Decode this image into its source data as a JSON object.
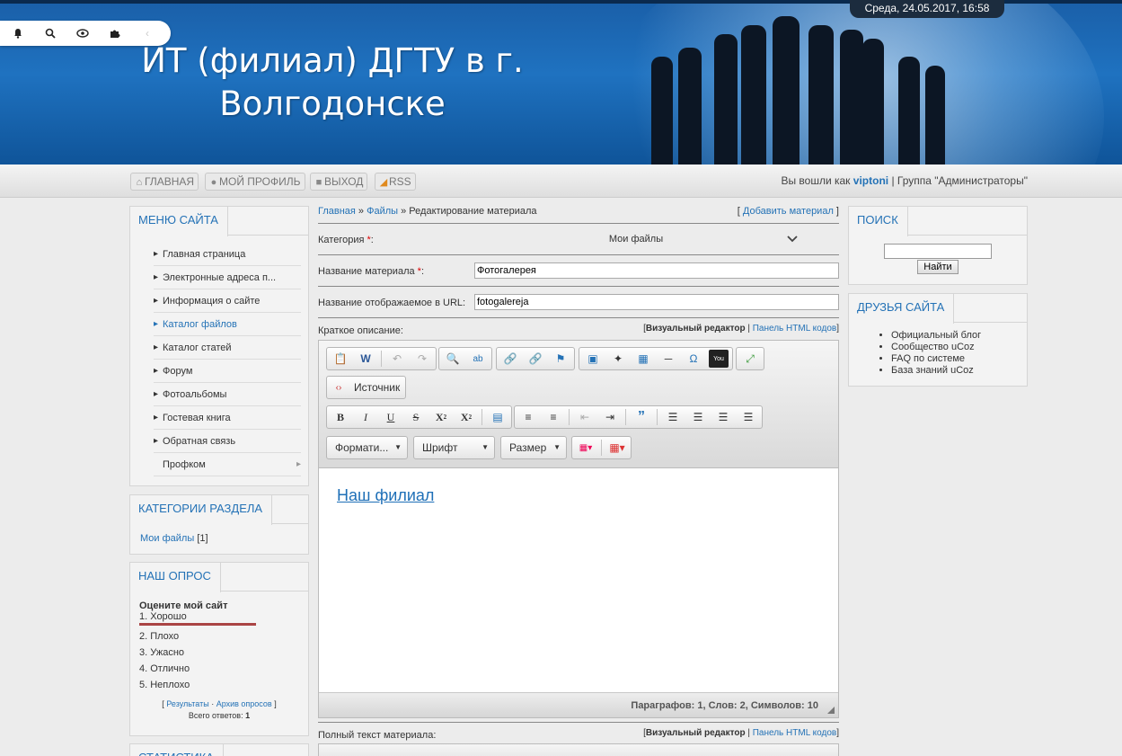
{
  "header": {
    "title_line1": "ИТ (филиал) ДГТУ в г.",
    "title_line2": "Волгодонске",
    "datetime": "Среда, 24.05.2017, 16:58"
  },
  "toolbar": {
    "icons": [
      "bell-icon",
      "search-icon",
      "eye-icon",
      "puzzle-icon",
      "collapse-icon"
    ]
  },
  "nav": {
    "home": "ГЛАВНАЯ",
    "profile": "МОЙ ПРОФИЛЬ",
    "logout": "ВЫХОД",
    "rss": "RSS",
    "logged_prefix": "Вы вошли как",
    "username": "viptoni",
    "group_text": "| Группа \"Администраторы\""
  },
  "left": {
    "menu_title": "МЕНЮ САЙТА",
    "menu_items": [
      "Главная страница",
      "Электронные адреса п...",
      "Информация о сайте",
      "Каталог файлов",
      "Каталог статей",
      "Форум",
      "Фотоальбомы",
      "Гостевая книга",
      "Обратная связь",
      "Профком"
    ],
    "categories_title": "КАТЕГОРИИ РАЗДЕЛА",
    "category_name": "Мои файлы",
    "category_count": "[1]",
    "poll_title": "НАШ ОПРОС",
    "poll_question": "Оцените мой сайт",
    "poll_options": [
      "1. Хорошо",
      "2. Плохо",
      "3. Ужасно",
      "4. Отлично",
      "5. Неплохо"
    ],
    "poll_results": "Результаты",
    "poll_archive": "Архив опросов",
    "poll_total_label": "Всего ответов:",
    "poll_total": "1",
    "stats_title": "СТАТИСТИКА"
  },
  "main": {
    "crumb_home": "Главная",
    "crumb_files": "Файлы",
    "crumb_current": "Редактирование материала",
    "add_material": "Добавить материал",
    "category_label": "Категория",
    "category_value": "Мои файлы",
    "name_label": "Название материала",
    "name_value": "Фотогалерея",
    "url_label": "Название отображаемое в URL:",
    "url_value": "fotogalereja",
    "short_desc_label": "Краткое описание:",
    "visual_editor": "Визуальный редактор",
    "html_panel": "Панель HTML кодов",
    "source_btn": "Источник",
    "format_combo": "Формати...",
    "font_combo": "Шрифт",
    "size_combo": "Размер",
    "editor_link": "Наш филиал",
    "status": "Параграфов: 1, Слов: 2, Символов: 10",
    "full_text_label": "Полный текст материала:"
  },
  "right": {
    "search_title": "ПОИСК",
    "search_button": "Найти",
    "search_value": "",
    "friends_title": "ДРУЗЬЯ САЙТА",
    "friends": [
      "Официальный блог",
      "Сообщество uCoz",
      "FAQ по системе",
      "База знаний uCoz"
    ]
  }
}
